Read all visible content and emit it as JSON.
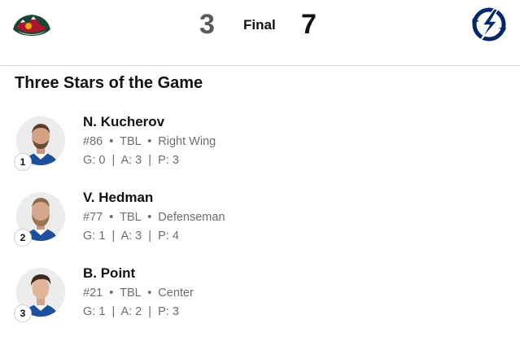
{
  "scoreboard": {
    "home_team_logo": "wild-logo-icon",
    "away_team_logo": "lightning-logo-icon",
    "home_score": "3",
    "status": "Final",
    "away_score": "7",
    "colors": {
      "wild_green": "#154734",
      "wild_red": "#a6192e",
      "lightning_blue": "#002868"
    }
  },
  "section": {
    "title": "Three Stars of the Game"
  },
  "stars": [
    {
      "rank": "1",
      "name": "N. Kucherov",
      "number": "#86",
      "team": "TBL",
      "position": "Right Wing",
      "goals": "G: 0",
      "assists": "A: 3",
      "points": "P: 3"
    },
    {
      "rank": "2",
      "name": "V. Hedman",
      "number": "#77",
      "team": "TBL",
      "position": "Defenseman",
      "goals": "G: 1",
      "assists": "A: 3",
      "points": "P: 4"
    },
    {
      "rank": "3",
      "name": "B. Point",
      "number": "#21",
      "team": "TBL",
      "position": "Center",
      "goals": "G: 1",
      "assists": "A: 2",
      "points": "P: 3"
    }
  ]
}
